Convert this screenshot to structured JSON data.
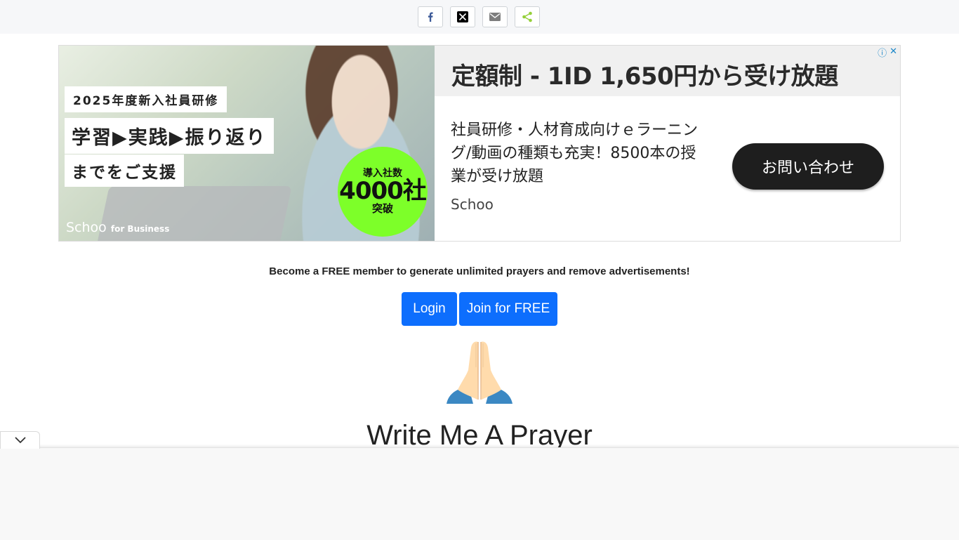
{
  "share": {
    "buttons": [
      {
        "name": "facebook",
        "icon": "facebook-icon",
        "color": "#3b5998"
      },
      {
        "name": "x",
        "icon": "x-twitter-icon",
        "color": "#000000"
      },
      {
        "name": "email",
        "icon": "email-icon",
        "color": "#7d7d7d"
      },
      {
        "name": "share",
        "icon": "share-icon",
        "color": "#95d03a"
      }
    ]
  },
  "ad": {
    "image_label_1": "2025年度新入社員研修",
    "image_label_2": "学習▶実践▶振り返り",
    "image_label_3": "までをご支援",
    "badge_line1": "導入社数",
    "badge_line2": "4000社",
    "badge_line3": "突破",
    "brand_name": "Schoo",
    "brand_for": "for Business",
    "headline": "定額制 - 1ID 1,650円から受け放題",
    "body": "社員研修・人材育成向けｅラーニング/動画の種類も充実！8500本の授業が受け放題",
    "advertiser": "Schoo",
    "cta": "お問い合わせ",
    "info_icon": "info-icon",
    "close_icon": "close-icon",
    "accent_color": "#7dff29"
  },
  "promo": {
    "text": "Become a FREE member to generate unlimited prayers and remove advertisements!"
  },
  "buttons": {
    "login": "Login",
    "join": "Join for FREE",
    "color": "#0d6efd"
  },
  "hero": {
    "icon": "praying-hands-icon",
    "title": "Write Me A Prayer"
  },
  "bottom": {
    "collapse_icon": "chevron-down-icon"
  }
}
